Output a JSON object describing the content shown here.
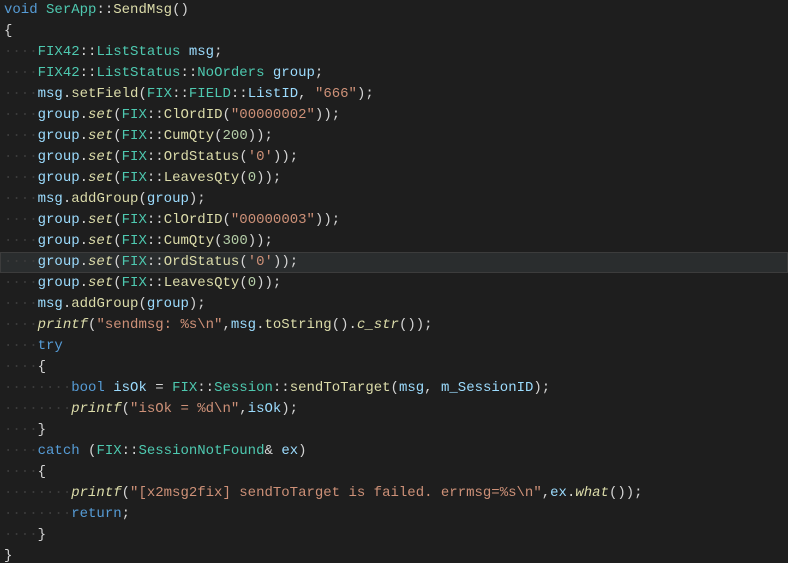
{
  "code": {
    "tokens": [
      [
        {
          "c": "kw",
          "t": "void"
        },
        {
          "c": "pun",
          "t": " "
        },
        {
          "c": "cls",
          "t": "SerApp"
        },
        {
          "c": "pun",
          "t": "::"
        },
        {
          "c": "fn",
          "t": "SendMsg"
        },
        {
          "c": "pun",
          "t": "()"
        }
      ],
      [
        {
          "c": "pun",
          "t": "{"
        }
      ],
      [
        {
          "c": "ws",
          "t": "····"
        },
        {
          "c": "cls",
          "t": "FIX42"
        },
        {
          "c": "pun",
          "t": "::"
        },
        {
          "c": "cls",
          "t": "ListStatus"
        },
        {
          "c": "pun",
          "t": " "
        },
        {
          "c": "var",
          "t": "msg"
        },
        {
          "c": "pun",
          "t": ";"
        }
      ],
      [
        {
          "c": "ws",
          "t": "····"
        },
        {
          "c": "cls",
          "t": "FIX42"
        },
        {
          "c": "pun",
          "t": "::"
        },
        {
          "c": "cls",
          "t": "ListStatus"
        },
        {
          "c": "pun",
          "t": "::"
        },
        {
          "c": "cls",
          "t": "NoOrders"
        },
        {
          "c": "pun",
          "t": " "
        },
        {
          "c": "var",
          "t": "group"
        },
        {
          "c": "pun",
          "t": ";"
        }
      ],
      [
        {
          "c": "ws",
          "t": "····"
        },
        {
          "c": "var",
          "t": "msg"
        },
        {
          "c": "pun",
          "t": "."
        },
        {
          "c": "fn",
          "t": "setField"
        },
        {
          "c": "pun",
          "t": "("
        },
        {
          "c": "cls",
          "t": "FIX"
        },
        {
          "c": "pun",
          "t": "::"
        },
        {
          "c": "cls",
          "t": "FIELD"
        },
        {
          "c": "pun",
          "t": "::"
        },
        {
          "c": "var",
          "t": "ListID"
        },
        {
          "c": "pun",
          "t": ", "
        },
        {
          "c": "str",
          "t": "\"666\""
        },
        {
          "c": "pun",
          "t": ");"
        }
      ],
      [
        {
          "c": "ws",
          "t": "····"
        },
        {
          "c": "var",
          "t": "group"
        },
        {
          "c": "pun",
          "t": "."
        },
        {
          "c": "fni",
          "t": "set"
        },
        {
          "c": "pun",
          "t": "("
        },
        {
          "c": "cls",
          "t": "FIX"
        },
        {
          "c": "pun",
          "t": "::"
        },
        {
          "c": "fn",
          "t": "ClOrdID"
        },
        {
          "c": "pun",
          "t": "("
        },
        {
          "c": "str",
          "t": "\"00000002\""
        },
        {
          "c": "pun",
          "t": "));"
        }
      ],
      [
        {
          "c": "ws",
          "t": "····"
        },
        {
          "c": "var",
          "t": "group"
        },
        {
          "c": "pun",
          "t": "."
        },
        {
          "c": "fni",
          "t": "set"
        },
        {
          "c": "pun",
          "t": "("
        },
        {
          "c": "cls",
          "t": "FIX"
        },
        {
          "c": "pun",
          "t": "::"
        },
        {
          "c": "fn",
          "t": "CumQty"
        },
        {
          "c": "pun",
          "t": "("
        },
        {
          "c": "num",
          "t": "200"
        },
        {
          "c": "pun",
          "t": "));"
        }
      ],
      [
        {
          "c": "ws",
          "t": "····"
        },
        {
          "c": "var",
          "t": "group"
        },
        {
          "c": "pun",
          "t": "."
        },
        {
          "c": "fni",
          "t": "set"
        },
        {
          "c": "pun",
          "t": "("
        },
        {
          "c": "cls",
          "t": "FIX"
        },
        {
          "c": "pun",
          "t": "::"
        },
        {
          "c": "fn",
          "t": "OrdStatus"
        },
        {
          "c": "pun",
          "t": "("
        },
        {
          "c": "str",
          "t": "'0'"
        },
        {
          "c": "pun",
          "t": "));"
        }
      ],
      [
        {
          "c": "ws",
          "t": "····"
        },
        {
          "c": "var",
          "t": "group"
        },
        {
          "c": "pun",
          "t": "."
        },
        {
          "c": "fni",
          "t": "set"
        },
        {
          "c": "pun",
          "t": "("
        },
        {
          "c": "cls",
          "t": "FIX"
        },
        {
          "c": "pun",
          "t": "::"
        },
        {
          "c": "fn",
          "t": "LeavesQty"
        },
        {
          "c": "pun",
          "t": "("
        },
        {
          "c": "num",
          "t": "0"
        },
        {
          "c": "pun",
          "t": "));"
        }
      ],
      [
        {
          "c": "ws",
          "t": "····"
        },
        {
          "c": "var",
          "t": "msg"
        },
        {
          "c": "pun",
          "t": "."
        },
        {
          "c": "fn",
          "t": "addGroup"
        },
        {
          "c": "pun",
          "t": "("
        },
        {
          "c": "var",
          "t": "group"
        },
        {
          "c": "pun",
          "t": ");"
        }
      ],
      [
        {
          "c": "ws",
          "t": "····"
        },
        {
          "c": "var",
          "t": "group"
        },
        {
          "c": "pun",
          "t": "."
        },
        {
          "c": "fni",
          "t": "set"
        },
        {
          "c": "pun",
          "t": "("
        },
        {
          "c": "cls",
          "t": "FIX"
        },
        {
          "c": "pun",
          "t": "::"
        },
        {
          "c": "fn",
          "t": "ClOrdID"
        },
        {
          "c": "pun",
          "t": "("
        },
        {
          "c": "str",
          "t": "\"00000003\""
        },
        {
          "c": "pun",
          "t": "));"
        }
      ],
      [
        {
          "c": "ws",
          "t": "····"
        },
        {
          "c": "var",
          "t": "group"
        },
        {
          "c": "pun",
          "t": "."
        },
        {
          "c": "fni",
          "t": "set"
        },
        {
          "c": "pun",
          "t": "("
        },
        {
          "c": "cls",
          "t": "FIX"
        },
        {
          "c": "pun",
          "t": "::"
        },
        {
          "c": "fn",
          "t": "CumQty"
        },
        {
          "c": "pun",
          "t": "("
        },
        {
          "c": "num",
          "t": "300"
        },
        {
          "c": "pun",
          "t": "));"
        }
      ],
      [
        {
          "c": "ws",
          "t": "····"
        },
        {
          "c": "var",
          "t": "group"
        },
        {
          "c": "pun",
          "t": "."
        },
        {
          "c": "fni",
          "t": "set"
        },
        {
          "c": "pun",
          "t": "("
        },
        {
          "c": "cls",
          "t": "FIX"
        },
        {
          "c": "pun",
          "t": "::"
        },
        {
          "c": "fn",
          "t": "OrdStatus"
        },
        {
          "c": "pun",
          "t": "("
        },
        {
          "c": "str",
          "t": "'0'"
        },
        {
          "c": "pun",
          "t": "));"
        }
      ],
      [
        {
          "c": "ws",
          "t": "····"
        },
        {
          "c": "var",
          "t": "group"
        },
        {
          "c": "pun",
          "t": "."
        },
        {
          "c": "fni",
          "t": "set"
        },
        {
          "c": "pun",
          "t": "("
        },
        {
          "c": "cls",
          "t": "FIX"
        },
        {
          "c": "pun",
          "t": "::"
        },
        {
          "c": "fn",
          "t": "LeavesQty"
        },
        {
          "c": "pun",
          "t": "("
        },
        {
          "c": "num",
          "t": "0"
        },
        {
          "c": "pun",
          "t": "));"
        }
      ],
      [
        {
          "c": "ws",
          "t": "····"
        },
        {
          "c": "var",
          "t": "msg"
        },
        {
          "c": "pun",
          "t": "."
        },
        {
          "c": "fn",
          "t": "addGroup"
        },
        {
          "c": "pun",
          "t": "("
        },
        {
          "c": "var",
          "t": "group"
        },
        {
          "c": "pun",
          "t": ");"
        }
      ],
      [
        {
          "c": "ws",
          "t": "····"
        },
        {
          "c": "fni",
          "t": "printf"
        },
        {
          "c": "pun",
          "t": "("
        },
        {
          "c": "str",
          "t": "\"sendmsg: %s\\n\""
        },
        {
          "c": "pun",
          "t": ","
        },
        {
          "c": "var",
          "t": "msg"
        },
        {
          "c": "pun",
          "t": "."
        },
        {
          "c": "fn",
          "t": "toString"
        },
        {
          "c": "pun",
          "t": "()."
        },
        {
          "c": "fni",
          "t": "c_str"
        },
        {
          "c": "pun",
          "t": "());"
        }
      ],
      [
        {
          "c": "ws",
          "t": "····"
        },
        {
          "c": "kw",
          "t": "try"
        }
      ],
      [
        {
          "c": "ws",
          "t": "····"
        },
        {
          "c": "pun",
          "t": "{"
        }
      ],
      [
        {
          "c": "ws",
          "t": "····"
        },
        {
          "c": "ws",
          "t": "····"
        },
        {
          "c": "kw",
          "t": "bool"
        },
        {
          "c": "pun",
          "t": " "
        },
        {
          "c": "var",
          "t": "isOk"
        },
        {
          "c": "pun",
          "t": " = "
        },
        {
          "c": "cls",
          "t": "FIX"
        },
        {
          "c": "pun",
          "t": "::"
        },
        {
          "c": "cls",
          "t": "Session"
        },
        {
          "c": "pun",
          "t": "::"
        },
        {
          "c": "fn",
          "t": "sendToTarget"
        },
        {
          "c": "pun",
          "t": "("
        },
        {
          "c": "var",
          "t": "msg"
        },
        {
          "c": "pun",
          "t": ", "
        },
        {
          "c": "var",
          "t": "m_SessionID"
        },
        {
          "c": "pun",
          "t": ");"
        }
      ],
      [
        {
          "c": "ws",
          "t": "····"
        },
        {
          "c": "ws",
          "t": "····"
        },
        {
          "c": "fni",
          "t": "printf"
        },
        {
          "c": "pun",
          "t": "("
        },
        {
          "c": "str",
          "t": "\"isOk = %d\\n\""
        },
        {
          "c": "pun",
          "t": ","
        },
        {
          "c": "var",
          "t": "isOk"
        },
        {
          "c": "pun",
          "t": ");"
        }
      ],
      [
        {
          "c": "ws",
          "t": "····"
        },
        {
          "c": "pun",
          "t": "}"
        }
      ],
      [
        {
          "c": "ws",
          "t": "····"
        },
        {
          "c": "kw",
          "t": "catch"
        },
        {
          "c": "pun",
          "t": " ("
        },
        {
          "c": "cls",
          "t": "FIX"
        },
        {
          "c": "pun",
          "t": "::"
        },
        {
          "c": "cls",
          "t": "SessionNotFound"
        },
        {
          "c": "pun",
          "t": "& "
        },
        {
          "c": "var",
          "t": "ex"
        },
        {
          "c": "pun",
          "t": ")"
        }
      ],
      [
        {
          "c": "ws",
          "t": "····"
        },
        {
          "c": "pun",
          "t": "{"
        }
      ],
      [
        {
          "c": "ws",
          "t": "····"
        },
        {
          "c": "ws",
          "t": "····"
        },
        {
          "c": "fni",
          "t": "printf"
        },
        {
          "c": "pun",
          "t": "("
        },
        {
          "c": "str",
          "t": "\"[x2msg2fix] sendToTarget is failed. errmsg=%s\\n\""
        },
        {
          "c": "pun",
          "t": ","
        },
        {
          "c": "var",
          "t": "ex"
        },
        {
          "c": "pun",
          "t": "."
        },
        {
          "c": "fni",
          "t": "what"
        },
        {
          "c": "pun",
          "t": "());"
        }
      ],
      [
        {
          "c": "ws",
          "t": "····"
        },
        {
          "c": "ws",
          "t": "····"
        },
        {
          "c": "kw",
          "t": "return"
        },
        {
          "c": "pun",
          "t": ";"
        }
      ],
      [
        {
          "c": "ws",
          "t": "····"
        },
        {
          "c": "pun",
          "t": "}"
        }
      ],
      [
        {
          "c": "pun",
          "t": "}"
        }
      ]
    ],
    "highlight_line_index": 12
  }
}
